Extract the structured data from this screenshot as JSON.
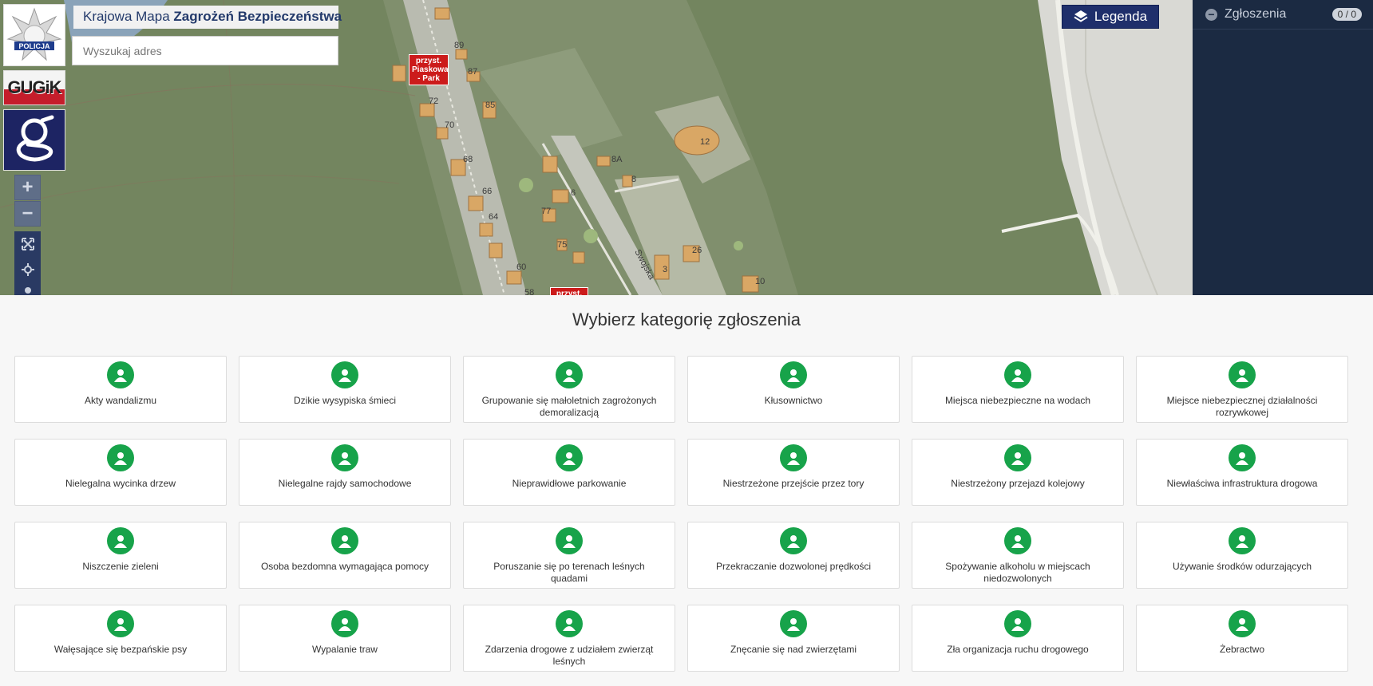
{
  "header": {
    "title_light": "Krajowa Mapa",
    "title_bold": "Zagrożeń Bezpieczeństwa",
    "search_placeholder": "Wyszukaj adres",
    "police_logo_text": "POLICJA",
    "gugik_logo_text": "GUGiK"
  },
  "map": {
    "legend_label": "Legenda",
    "zoom_in": "+",
    "zoom_out": "−",
    "pins": [
      "przyst. Piaskowa - Park",
      "przyst."
    ],
    "street": "Swojska",
    "house_numbers": [
      "89",
      "87",
      "85",
      "72",
      "70",
      "68",
      "66",
      "64",
      "60",
      "58",
      "77",
      "75",
      "6",
      "8",
      "8A",
      "3",
      "26",
      "12",
      "10"
    ]
  },
  "sidebar": {
    "title": "Zgłoszenia",
    "count": "0 / 0"
  },
  "categories": {
    "heading": "Wybierz kategorię zgłoszenia",
    "items": [
      {
        "label": "Akty wandalizmu",
        "icon": "vandalism-icon"
      },
      {
        "label": "Dzikie wysypiska śmieci",
        "icon": "trash-dump-icon"
      },
      {
        "label": "Grupowanie się małoletnich zagrożonych demoralizacją",
        "icon": "youth-group-icon"
      },
      {
        "label": "Kłusownictwo",
        "icon": "poaching-icon"
      },
      {
        "label": "Miejsca niebezpieczne na wodach",
        "icon": "water-danger-icon"
      },
      {
        "label": "Miejsce niebezpiecznej działalności rozrywkowej",
        "icon": "dangerous-entertainment-icon"
      },
      {
        "label": "Nielegalna wycinka drzew",
        "icon": "tree-cutting-icon"
      },
      {
        "label": "Nielegalne rajdy samochodowe",
        "icon": "car-race-icon"
      },
      {
        "label": "Nieprawidłowe parkowanie",
        "icon": "parking-icon"
      },
      {
        "label": "Niestrzeżone przejście przez tory",
        "icon": "track-crossing-icon"
      },
      {
        "label": "Niestrzeżony przejazd kolejowy",
        "icon": "railway-crossing-icon"
      },
      {
        "label": "Niewłaściwa infrastruktura drogowa",
        "icon": "road-infrastructure-icon"
      },
      {
        "label": "Niszczenie zieleni",
        "icon": "greenery-damage-icon"
      },
      {
        "label": "Osoba bezdomna wymagająca pomocy",
        "icon": "homeless-person-icon"
      },
      {
        "label": "Poruszanie się po terenach leśnych quadami",
        "icon": "quad-forest-icon"
      },
      {
        "label": "Przekraczanie dozwolonej prędkości",
        "icon": "speeding-icon"
      },
      {
        "label": "Spożywanie alkoholu w miejscach niedozwolonych",
        "icon": "alcohol-icon"
      },
      {
        "label": "Używanie środków odurzających",
        "icon": "drugs-icon"
      },
      {
        "label": "Wałęsające się bezpańskie psy",
        "icon": "stray-dog-icon"
      },
      {
        "label": "Wypalanie traw",
        "icon": "grass-burning-icon"
      },
      {
        "label": "Zdarzenia drogowe z udziałem zwierząt leśnych",
        "icon": "wildlife-accident-icon"
      },
      {
        "label": "Znęcanie się nad zwierzętami",
        "icon": "animal-abuse-icon"
      },
      {
        "label": "Zła organizacja ruchu drogowego",
        "icon": "traffic-organization-icon"
      },
      {
        "label": "Żebractwo",
        "icon": "begging-icon"
      }
    ]
  },
  "colors": {
    "category_icon": "#17a34a",
    "sidebar_bg": "#1b2a42",
    "legend_bg": "#1f2f6b",
    "pin_red": "#cc1b1b"
  }
}
